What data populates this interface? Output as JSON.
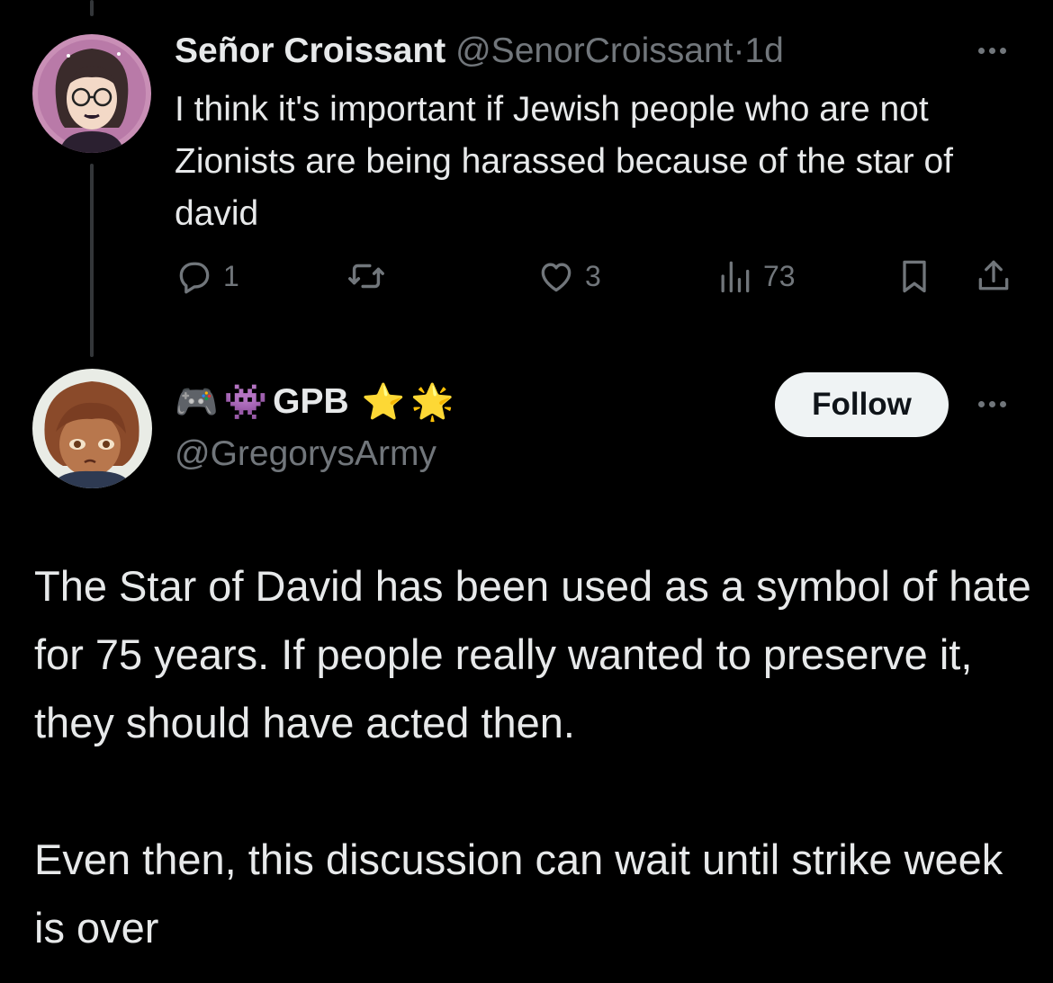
{
  "colors": {
    "background": "#000000",
    "text": "#e7e9ea",
    "muted": "#71767b",
    "follow_bg": "#eff3f4",
    "follow_text": "#0f1419"
  },
  "tweet1": {
    "display_name": "Señor Croissant",
    "handle": "@SenorCroissant",
    "separator": "·",
    "time": "1d",
    "text": "I think it's important if Jewish people who are not Zionists are being harassed because of the star of david",
    "actions": {
      "reply_icon": "reply-icon",
      "reply_count": "1",
      "retweet_icon": "retweet-icon",
      "like_icon": "heart-icon",
      "like_count": "3",
      "views_icon": "views-icon",
      "view_count": "73",
      "bookmark_icon": "bookmark-icon",
      "share_icon": "share-icon"
    }
  },
  "tweet2": {
    "name_emojis": [
      "🎮",
      "👾"
    ],
    "display_name": "GPB",
    "trailing_emojis": [
      "⭐",
      "🌟"
    ],
    "handle": "@GregorysArmy",
    "follow_label": "Follow",
    "paragraphs": [
      "The Star of David has been used as a symbol of hate for 75 years. If people really wanted to preserve it, they should have acted then.",
      "Even then, this discussion can wait until strike week is over"
    ]
  }
}
